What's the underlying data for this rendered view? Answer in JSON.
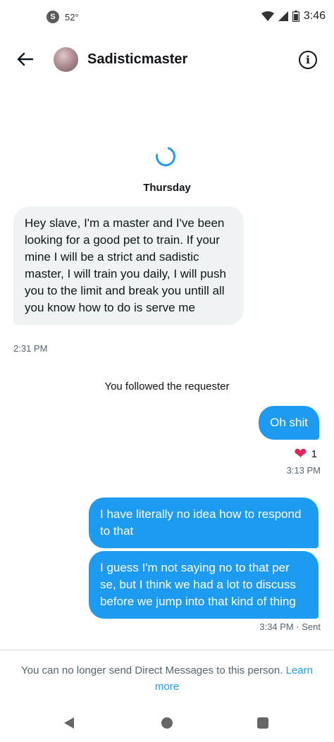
{
  "status_bar": {
    "temperature": "52°",
    "time": "3:46",
    "icons": [
      "shazam-icon",
      "wifi-icon",
      "signal-icon",
      "battery-icon"
    ]
  },
  "header": {
    "title": "Sadisticmaster",
    "info_glyph": "i"
  },
  "conversation": {
    "day_label": "Thursday",
    "incoming_message": "Hey slave, I'm a master and I've been looking for a good pet to train. If your mine I will be a strict and sadistic master, I will train you daily, I will push you to the limit and break you untill all you know how to do is serve me",
    "incoming_time": "2:31 PM",
    "system_notice": "You followed the requester",
    "outgoing_1": "Oh shit",
    "reaction_emoji": "❤",
    "reaction_count": "1",
    "outgoing_1_time": "3:13 PM",
    "outgoing_2": "I have literally no idea how to respond to that",
    "outgoing_3": "I guess I'm not saying no to that per se, but I think we had a lot to discuss before we jump into that kind of thing",
    "outgoing_3_time": "3:34 PM · Sent"
  },
  "footer": {
    "notice_text": "You can no longer send Direct Messages to this person.",
    "learn_more": "Learn more"
  },
  "colors": {
    "accent": "#1d9bf0",
    "incoming_bubble": "#eff3f4",
    "heart": "#e0245e"
  }
}
